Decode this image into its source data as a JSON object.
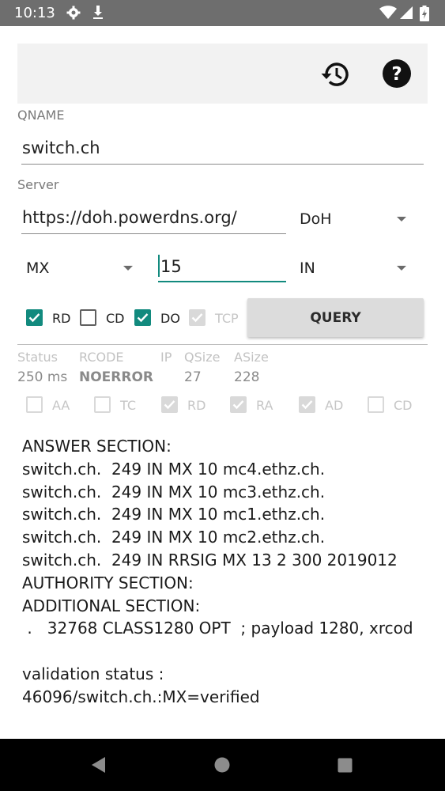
{
  "status_bar": {
    "time": "10:13",
    "icons": [
      "settings-icon",
      "download-icon",
      "wifi-icon",
      "signal-icon",
      "battery-icon"
    ]
  },
  "toolbar": {
    "icons": [
      "history-icon",
      "help-icon"
    ]
  },
  "qname": {
    "label": "QNAME",
    "value": "switch.ch"
  },
  "server": {
    "label": "Server",
    "value": "https://doh.powerdns.org/",
    "protocol": "DoH"
  },
  "query": {
    "type": "MX",
    "size": "15",
    "class": "IN"
  },
  "flags": [
    {
      "label": "RD",
      "checked": true,
      "enabled": true
    },
    {
      "label": "CD",
      "checked": false,
      "enabled": true
    },
    {
      "label": "DO",
      "checked": true,
      "enabled": true
    },
    {
      "label": "TCP",
      "checked": true,
      "enabled": false
    }
  ],
  "query_button": "QUERY",
  "result_headers": {
    "status": "Status",
    "rcode": "RCODE",
    "ip": "IP",
    "qsize": "QSize",
    "asize": "ASize"
  },
  "result_values": {
    "status": "250 ms",
    "rcode": "NOERROR",
    "ip": "",
    "qsize": "27",
    "asize": "228"
  },
  "response_flags": [
    {
      "label": "AA",
      "checked": false
    },
    {
      "label": "TC",
      "checked": false
    },
    {
      "label": "RD",
      "checked": true
    },
    {
      "label": "RA",
      "checked": true
    },
    {
      "label": "AD",
      "checked": true
    },
    {
      "label": "CD",
      "checked": false
    }
  ],
  "answer_lines": [
    "ANSWER SECTION:",
    "switch.ch.  249 IN MX 10 mc4.ethz.ch.",
    "switch.ch.  249 IN MX 10 mc3.ethz.ch.",
    "switch.ch.  249 IN MX 10 mc1.ethz.ch.",
    "switch.ch.  249 IN MX 10 mc2.ethz.ch.",
    "switch.ch.  249 IN RRSIG MX 13 2 300 2019012",
    "AUTHORITY SECTION:",
    "ADDITIONAL SECTION:",
    " .   32768 CLASS1280 OPT  ; payload 1280, xrcod",
    "",
    "validation status :",
    "46096/switch.ch.:MX=verified"
  ],
  "colors": {
    "accent": "#128a7e",
    "status_bar": "#6e6e6e",
    "nav_bar": "#000000"
  }
}
